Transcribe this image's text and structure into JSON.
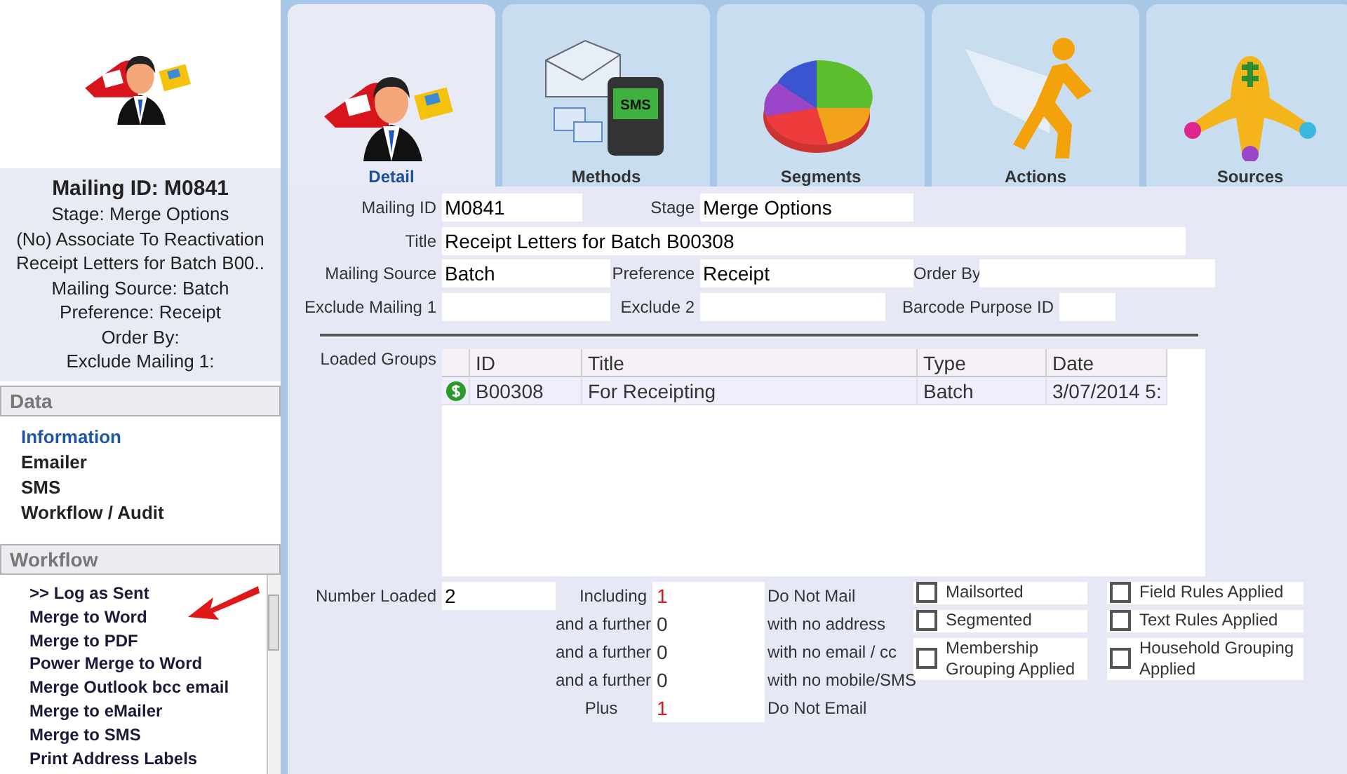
{
  "sidebar": {
    "title": "Mailing ID: M0841",
    "summary": [
      "Stage: Merge Options",
      "(No) Associate To Reactivation",
      "Receipt Letters for Batch B00..",
      "Mailing Source: Batch",
      "Preference: Receipt",
      "Order By:",
      "Exclude Mailing 1:"
    ],
    "sections": [
      {
        "heading": "Data",
        "kind": "links",
        "items": [
          {
            "label": "Information",
            "selected": true
          },
          {
            "label": "Emailer",
            "selected": false
          },
          {
            "label": "SMS",
            "selected": false
          },
          {
            "label": "Workflow / Audit",
            "selected": false
          }
        ]
      },
      {
        "heading": "Workflow",
        "kind": "scroll",
        "items": [
          {
            "label": ">> Log as Sent",
            "selected": false
          },
          {
            "label": "Merge to Word",
            "selected": false
          },
          {
            "label": "Merge to PDF",
            "selected": false
          },
          {
            "label": "Power Merge to Word",
            "selected": false
          },
          {
            "label": "Merge Outlook bcc email",
            "selected": false
          },
          {
            "label": "Merge to eMailer",
            "selected": false
          },
          {
            "label": "Merge to SMS",
            "selected": false
          },
          {
            "label": "Print Address Labels",
            "selected": false
          }
        ]
      }
    ]
  },
  "tabs": [
    {
      "label": "Detail",
      "kind": "detail",
      "selected": true
    },
    {
      "label": "Methods",
      "kind": "methods",
      "icon_text": "SMS",
      "selected": false
    },
    {
      "label": "Segments",
      "kind": "segments",
      "selected": false
    },
    {
      "label": "Actions",
      "kind": "actions",
      "selected": false
    },
    {
      "label": "Sources",
      "kind": "sources",
      "selected": false
    }
  ],
  "form": {
    "mailing_id": {
      "label": "Mailing ID",
      "value": "M0841"
    },
    "stage": {
      "label": "Stage",
      "value": "Merge Options"
    },
    "title": {
      "label": "Title",
      "value": "Receipt Letters for Batch B00308"
    },
    "mailing_source": {
      "label": "Mailing Source",
      "value": "Batch"
    },
    "preference": {
      "label": "Preference",
      "value": "Receipt"
    },
    "order_by": {
      "label": "Order By"
    },
    "exclude_mailing_1": {
      "label": "Exclude Mailing 1"
    },
    "exclude_2": {
      "label": "Exclude 2"
    },
    "barcode_purpose_id": {
      "label": "Barcode Purpose ID"
    }
  },
  "loaded_groups": {
    "label": "Loaded Groups",
    "columns": [
      "ID",
      "Title",
      "Type",
      "Date"
    ],
    "rows": [
      {
        "cells": [
          "B00308",
          "For Receipting",
          "Batch",
          "3/07/2014 5:"
        ]
      }
    ]
  },
  "counts": {
    "number_loaded": {
      "label": "Number Loaded",
      "value": "2"
    },
    "rows": [
      {
        "label": "Including",
        "value": "1",
        "alert": true,
        "note": "Do Not Mail"
      },
      {
        "label": "and a further",
        "value": "0",
        "alert": false,
        "note": "with no address"
      },
      {
        "label": "and a further",
        "value": "0",
        "alert": false,
        "note": "with no email / cc"
      },
      {
        "label": "and a further",
        "value": "0",
        "alert": false,
        "note": "with no mobile/SMS"
      },
      {
        "label": "Plus",
        "value": "1",
        "alert": true,
        "note": "Do Not Email"
      }
    ]
  },
  "checks": [
    [
      {
        "label": "Mailsorted",
        "checked": false
      },
      {
        "label": "Segmented",
        "checked": false
      },
      {
        "label": "Membership Grouping Applied",
        "checked": false
      }
    ],
    [
      {
        "label": "Field Rules Applied",
        "checked": false
      },
      {
        "label": "Text Rules Applied",
        "checked": false
      },
      {
        "label": "Household Grouping Applied",
        "checked": false
      }
    ]
  ]
}
